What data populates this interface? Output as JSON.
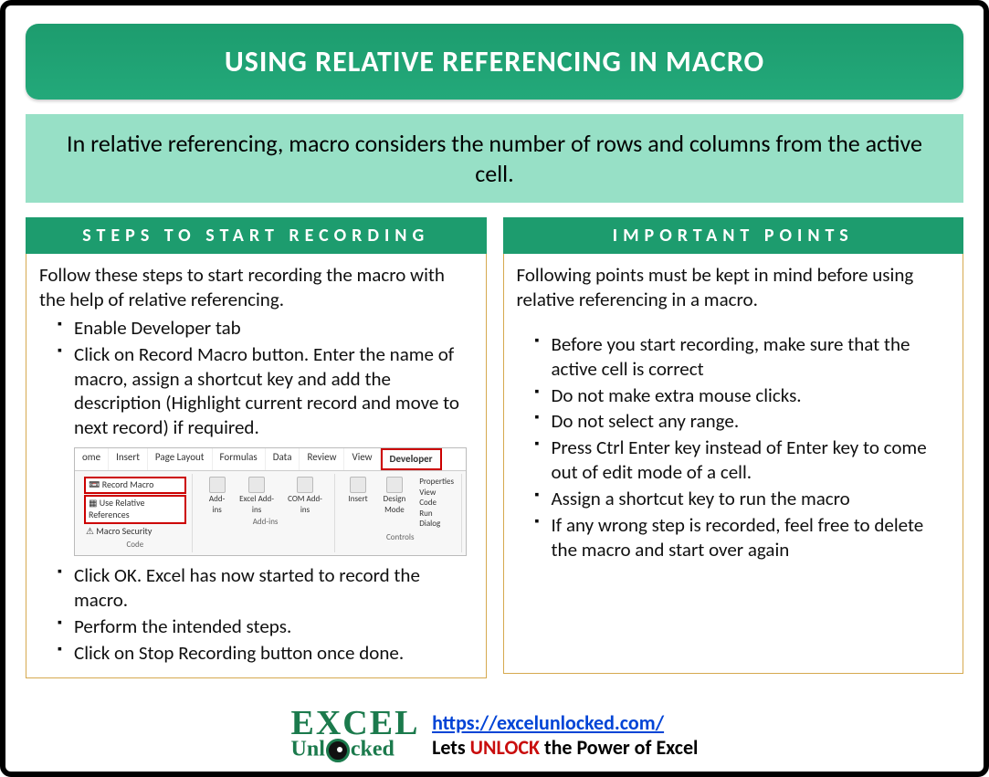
{
  "title": "USING RELATIVE REFERENCING IN MACRO",
  "intro": "In relative referencing, macro considers the number of rows and columns from the active cell.",
  "left": {
    "header": "STEPS TO START RECORDING",
    "lead": "Follow these steps to start recording the macro with the help of relative referencing.",
    "items_pre": [
      "Enable Developer tab",
      "Click on Record Macro button. Enter the name of macro, assign a shortcut key and add the description (Highlight current record and move to next record) if required."
    ],
    "items_post": [
      "Click OK. Excel has now started to record the macro.",
      "Perform the intended steps.",
      "Click on Stop Recording button once done."
    ]
  },
  "right": {
    "header": "IMPORTANT POINTS",
    "lead": "Following points must be kept in mind before using relative referencing in a macro.",
    "items": [
      "Before you start recording, make sure that the active cell is correct",
      "Do not make extra mouse clicks.",
      "Do not select any range.",
      "Press Ctrl Enter key instead of Enter key to come out of edit mode of a cell.",
      "Assign a shortcut key to run the macro",
      "If any wrong step is recorded, feel free to delete the macro and start over again"
    ]
  },
  "ribbon": {
    "tabs": [
      "ome",
      "Insert",
      "Page Layout",
      "Formulas",
      "Data",
      "Review",
      "View",
      "Developer"
    ],
    "code_items": [
      "Record Macro",
      "Use Relative References"
    ],
    "macro_security": "Macro Security",
    "group_code": "Code",
    "addins": [
      "Add-ins",
      "Excel Add-ins",
      "COM Add-ins"
    ],
    "group_addins": "Add-ins",
    "controls": [
      "Insert",
      "Design Mode"
    ],
    "controls_right": [
      "Properties",
      "View Code",
      "Run Dialog"
    ],
    "group_controls": "Controls"
  },
  "footer": {
    "logo_top": "EXCEL",
    "logo_bot_pre": "Unl",
    "logo_bot_post": "cked",
    "url": "https://excelunlocked.com/",
    "tagline_pre": "Lets ",
    "tagline_mid": "UNLOCK",
    "tagline_post": " the Power of Excel"
  }
}
